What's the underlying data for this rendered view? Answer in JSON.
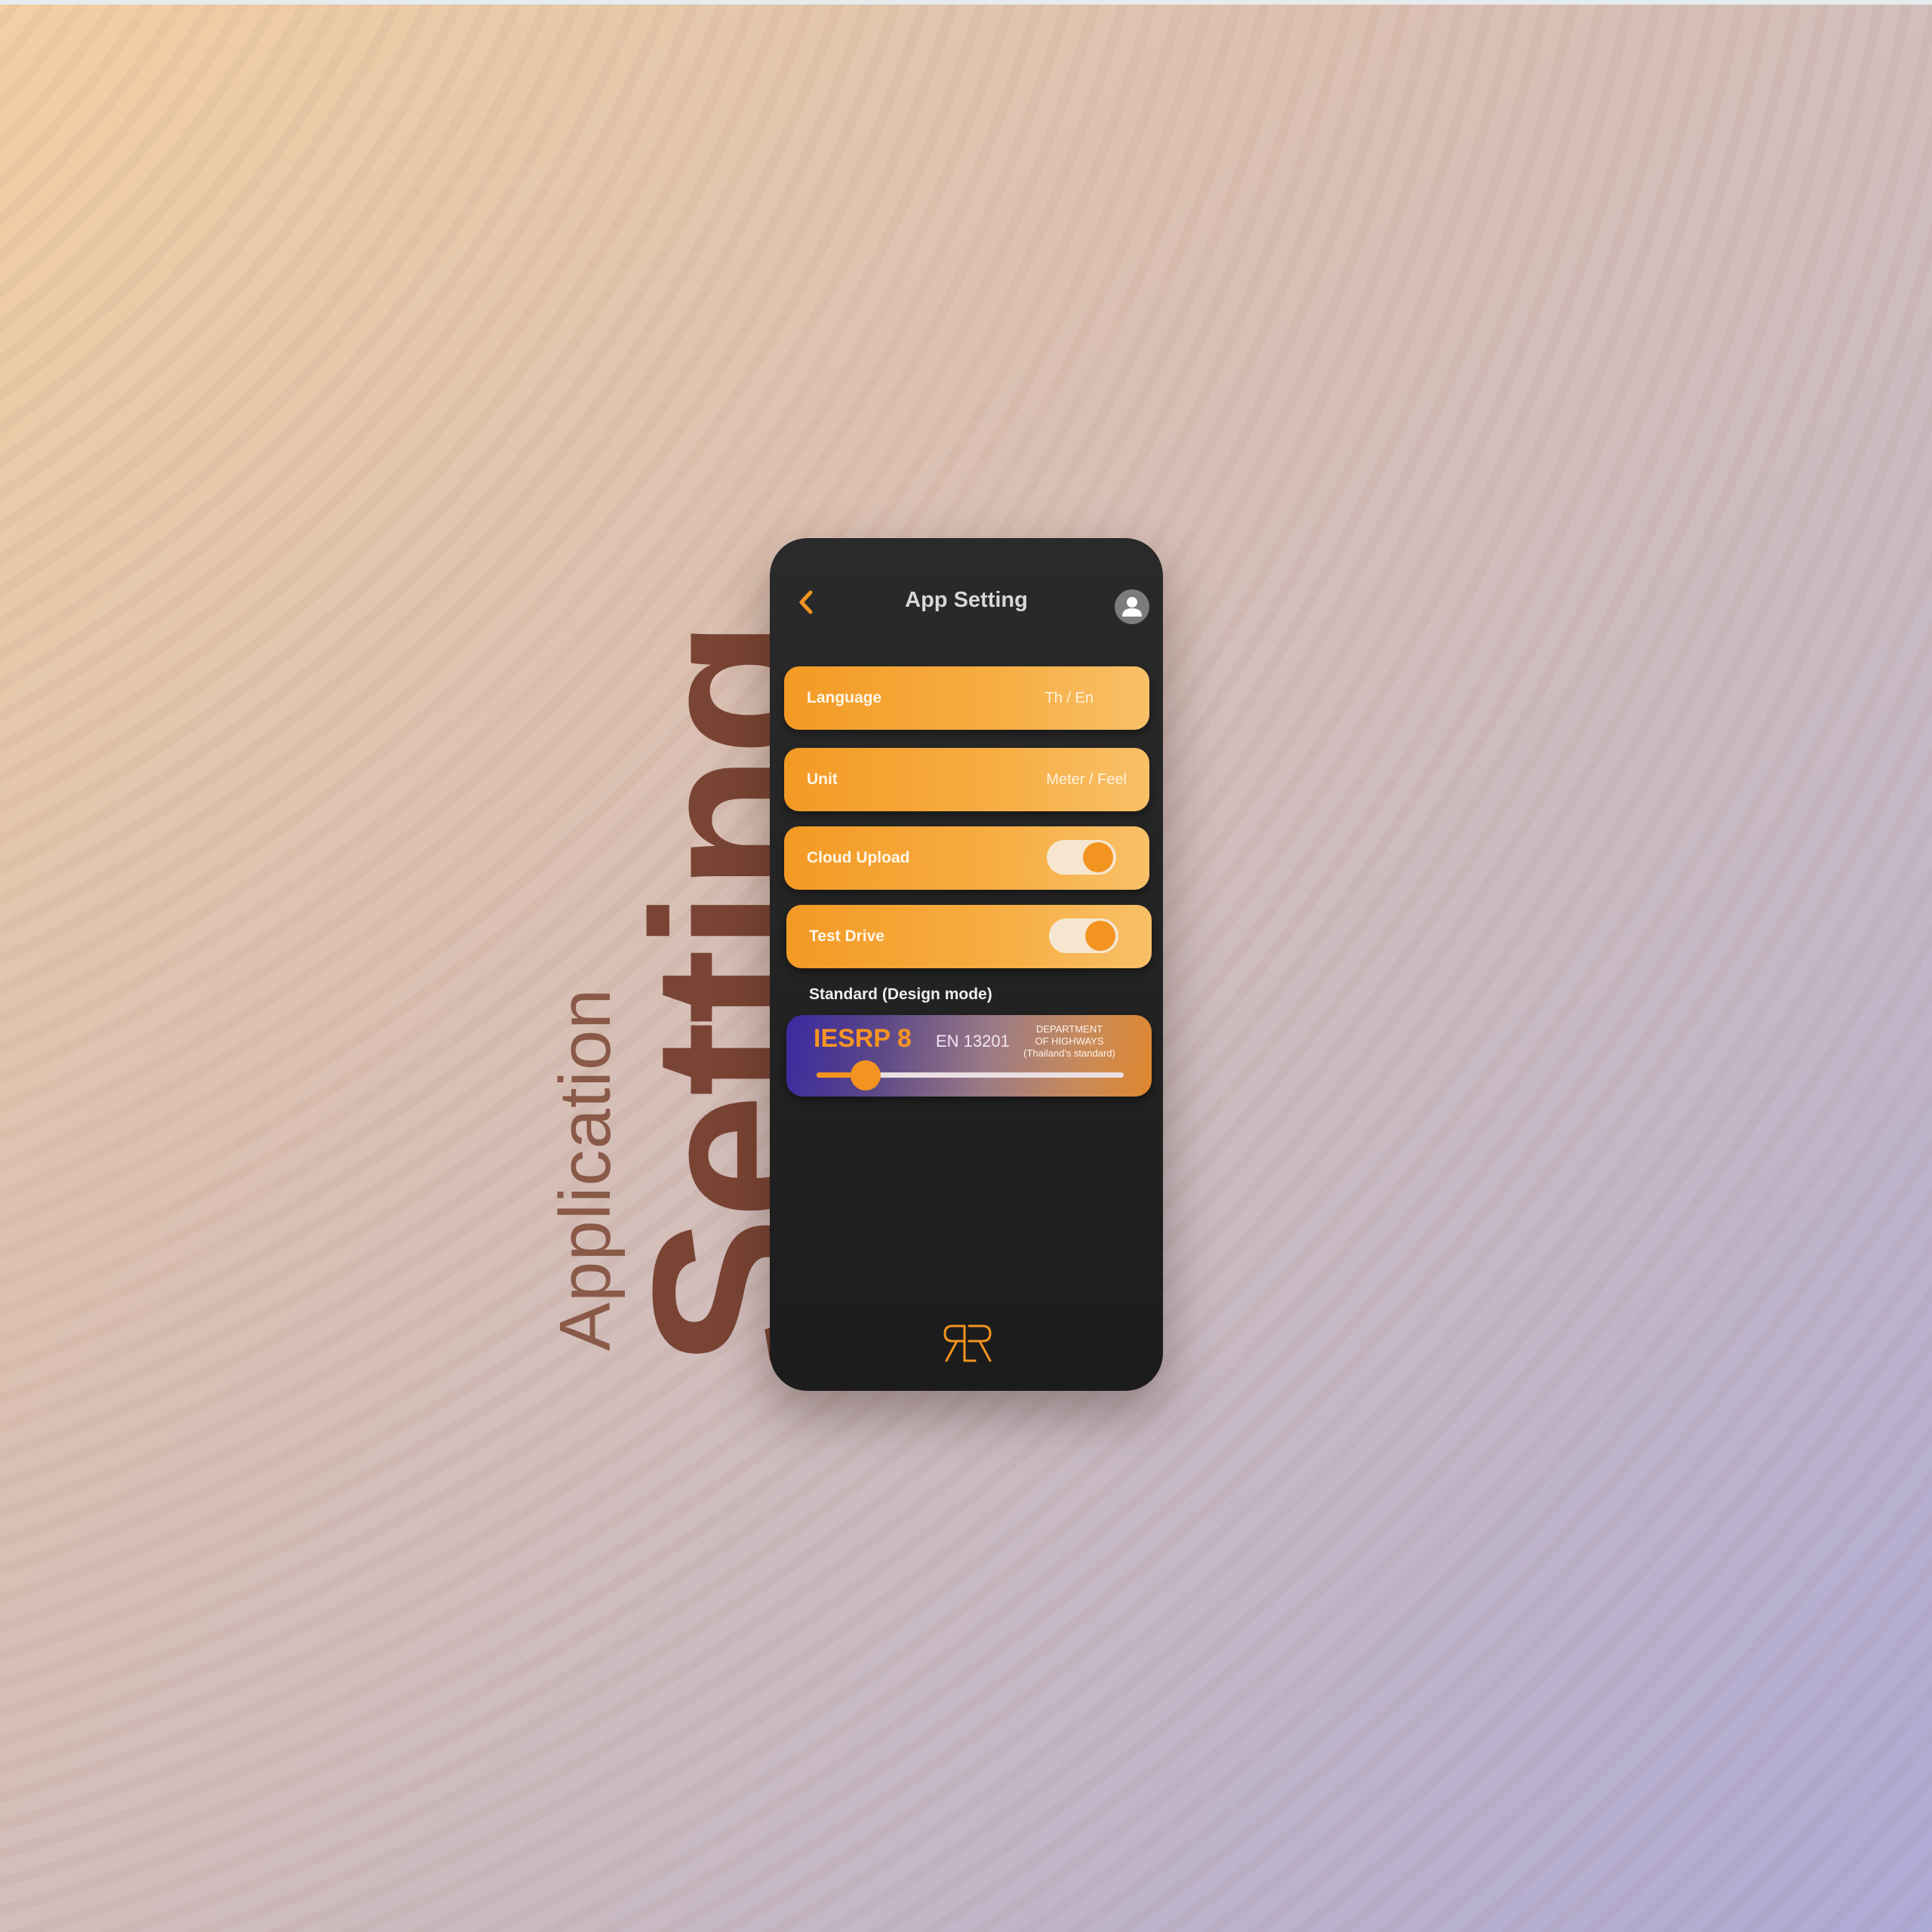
{
  "background": {
    "word_small": "Application",
    "word_large": "Setting"
  },
  "header": {
    "back_icon": "chevron-left-icon",
    "title": "App Setting",
    "avatar_icon": "user-icon"
  },
  "settings": {
    "language": {
      "label": "Language",
      "value": "Th / En"
    },
    "unit": {
      "label": "Unit",
      "value": "Meter / Feel"
    },
    "cloud_upload": {
      "label": "Cloud Upload",
      "enabled": true
    },
    "test_drive": {
      "label": "Test Drive",
      "enabled": true
    }
  },
  "standard": {
    "section_label": "Standard (Design mode)",
    "options": [
      {
        "label": "IESRP 8"
      },
      {
        "label": "EN 13201"
      },
      {
        "line1": "DEPARTMENT",
        "line2": "OF HIGHWAYS",
        "line3": "(Thailand's standard)"
      }
    ],
    "slider_value": 0.16
  },
  "colors": {
    "accent": "#f39420",
    "phone_bg": "#1f1f1f"
  },
  "footer": {
    "logo_icon": "rr-logo-icon"
  }
}
